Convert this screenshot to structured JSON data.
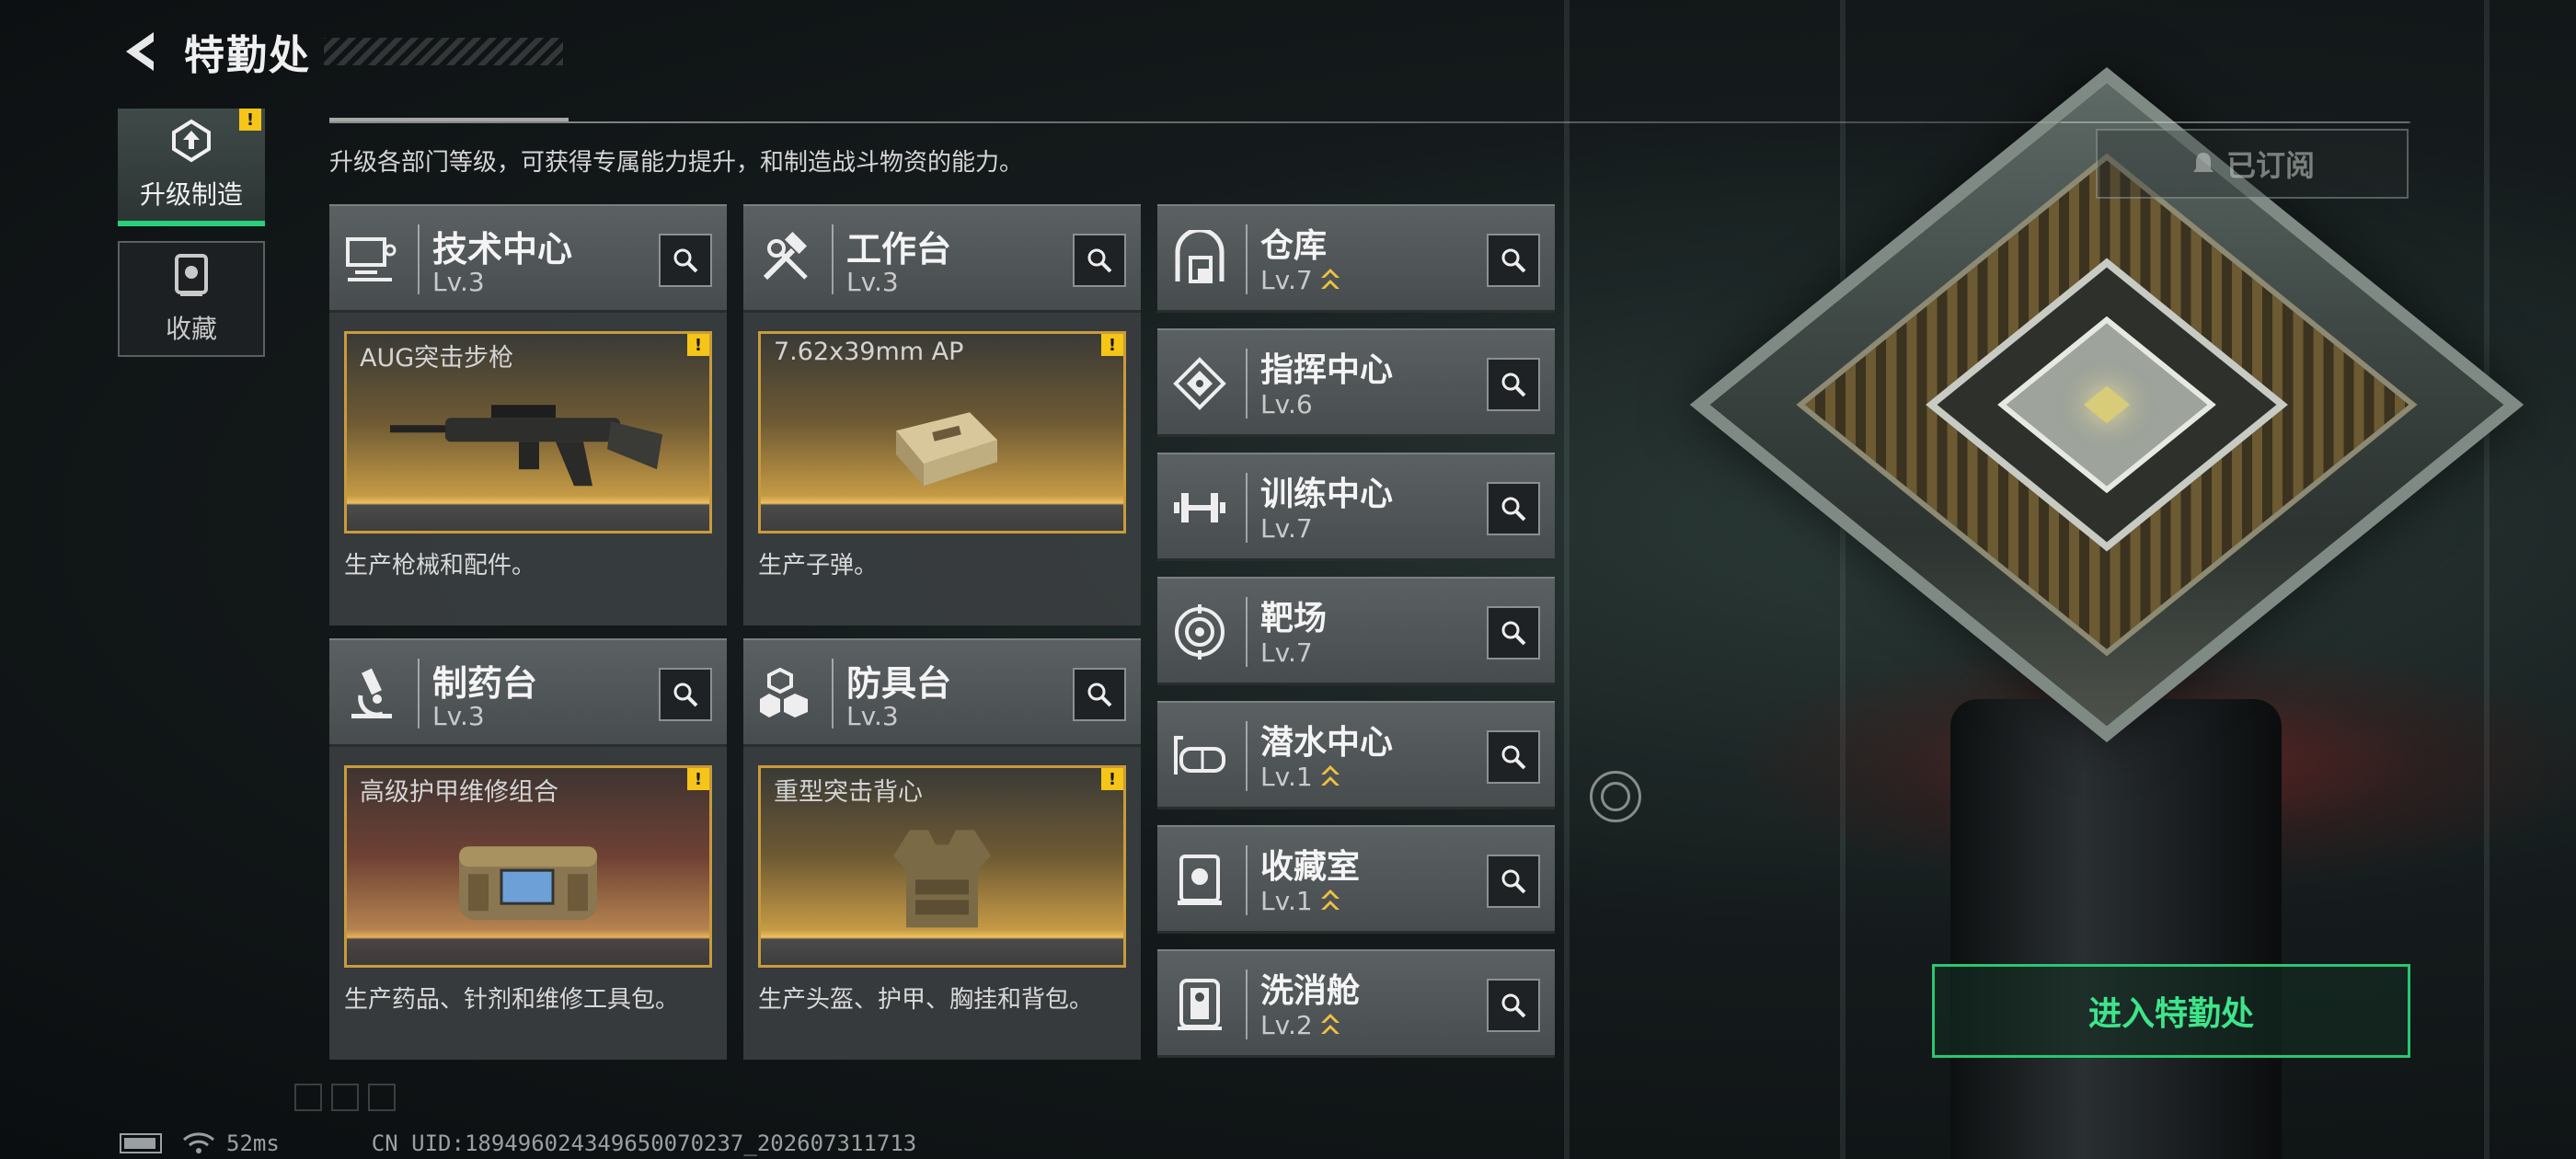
{
  "header": {
    "title": "特勤处",
    "back_icon": "back-arrow-icon"
  },
  "tabs": [
    {
      "label": "升级制造",
      "icon": "upgrade-build-icon",
      "active": true,
      "alert": "!"
    },
    {
      "label": "收藏",
      "icon": "collection-icon",
      "active": false
    }
  ],
  "description": "升级各部门等级，可获得专属能力提升，和制造战斗物资的能力。",
  "main_facilities": [
    {
      "name": "技术中心",
      "level": "Lv.3",
      "icon": "computer-icon",
      "product": "AUG突击步枪",
      "product_alert": "!",
      "desc": "生产枪械和配件。"
    },
    {
      "name": "工作台",
      "level": "Lv.3",
      "icon": "hammer-wrench-icon",
      "product": "7.62x39mm AP",
      "product_alert": "!",
      "desc": "生产子弹。"
    },
    {
      "name": "制药台",
      "level": "Lv.3",
      "icon": "microscope-icon",
      "product": "高级护甲维修组合",
      "product_alert": "!",
      "desc": "生产药品、针剂和维修工具包。"
    },
    {
      "name": "防具台",
      "level": "Lv.3",
      "icon": "armor-cubes-icon",
      "product": "重型突击背心",
      "product_alert": "!",
      "desc": "生产头盔、护甲、胸挂和背包。"
    }
  ],
  "side_facilities": [
    {
      "name": "仓库",
      "level": "Lv.7",
      "icon": "warehouse-icon",
      "upgradable": true
    },
    {
      "name": "指挥中心",
      "level": "Lv.6",
      "icon": "command-center-icon",
      "upgradable": false
    },
    {
      "name": "训练中心",
      "level": "Lv.7",
      "icon": "dumbbell-icon",
      "upgradable": false
    },
    {
      "name": "靶场",
      "level": "Lv.7",
      "icon": "target-icon",
      "upgradable": false
    },
    {
      "name": "潜水中心",
      "level": "Lv.1",
      "icon": "diving-mask-icon",
      "upgradable": true
    },
    {
      "name": "收藏室",
      "level": "Lv.1",
      "icon": "display-case-icon",
      "upgradable": true
    },
    {
      "name": "洗消舱",
      "level": "Lv.2",
      "icon": "decon-pod-icon",
      "upgradable": true
    }
  ],
  "subscribed_button": "已订阅",
  "enter_button": "进入特勤处",
  "status": {
    "ping": "52ms",
    "uid": "CN UID:18949602434965007023​7_202607311713"
  },
  "colors": {
    "accent_green": "#29c770",
    "alert_yellow": "#f5c518",
    "product_border": "#c89b3c"
  }
}
